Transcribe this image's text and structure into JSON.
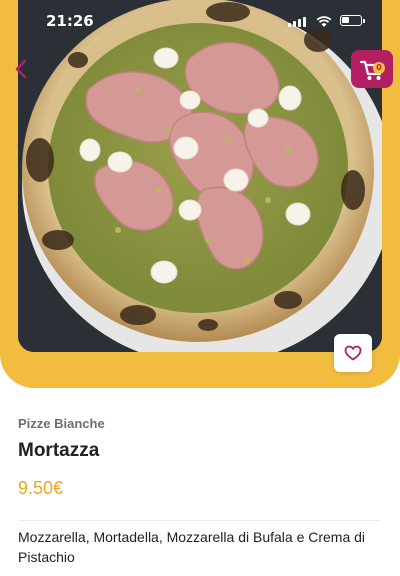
{
  "status_bar": {
    "time": "21:26"
  },
  "header": {
    "back_icon": "chevron-left-icon",
    "cart_icon": "cart-icon",
    "cart_count": "0"
  },
  "product": {
    "image_alt": "Pizza Mortazza with mortadella, mozzarella di bufala and pistachio",
    "category": "Pizze Bianche",
    "name": "Mortazza",
    "price": "9.50€",
    "description": "Mozzarella, Mortadella, Mozzarella di Bufala e Crema di Pistachio",
    "favorite_icon": "heart-outline-icon"
  },
  "colors": {
    "accent": "#f2bc3f",
    "cart": "#b41e63",
    "price": "#e6a921",
    "heart": "#b41e63"
  }
}
